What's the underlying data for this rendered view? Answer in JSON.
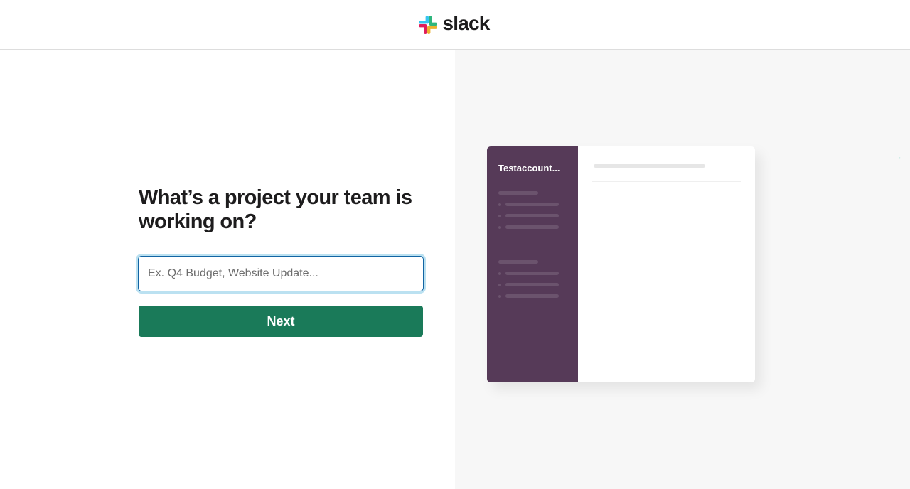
{
  "header": {
    "logo_text": "slack",
    "logo_colors": {
      "blue": "#36c5f0",
      "green": "#2eb67d",
      "yellow": "#ecb22e",
      "red": "#e01e5a"
    }
  },
  "form": {
    "heading": "What’s a project your team is working on?",
    "input_placeholder": "Ex. Q4 Budget, Website Update...",
    "input_value": "",
    "next_label": "Next",
    "accent_color": "#1a7a59"
  },
  "preview": {
    "workspace_name": "Testaccount...",
    "sidebar_color": "#563a58"
  }
}
